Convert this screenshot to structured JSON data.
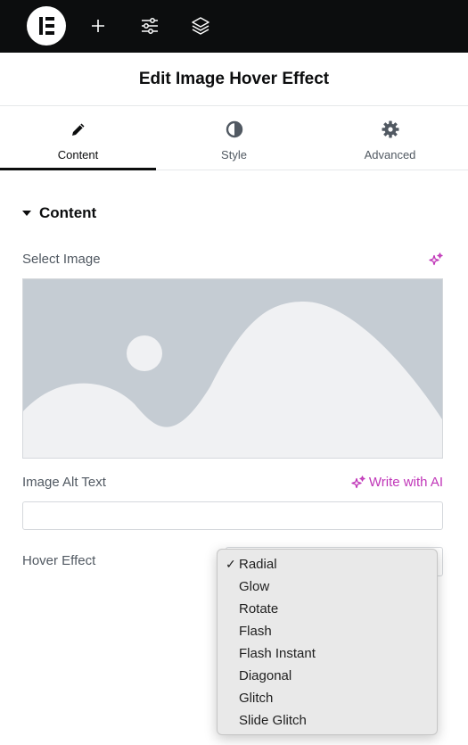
{
  "topbar": {
    "logo_icon": "elementor-logo-icon",
    "add_icon": "plus-icon",
    "settings_icon": "sliders-icon",
    "structure_icon": "layers-icon"
  },
  "header": {
    "title": "Edit Image Hover Effect"
  },
  "tabs": [
    {
      "label": "Content",
      "icon": "pencil-icon",
      "active": true
    },
    {
      "label": "Style",
      "icon": "half-circle-icon",
      "active": false
    },
    {
      "label": "Advanced",
      "icon": "gear-icon",
      "active": false
    }
  ],
  "section": {
    "title": "Content"
  },
  "fields": {
    "select_image": {
      "label": "Select Image",
      "ai_icon": "sparkle-icon"
    },
    "alt_text": {
      "label": "Image Alt Text",
      "ai_button": "Write with AI",
      "value": ""
    },
    "hover_effect": {
      "label": "Hover Effect",
      "selected": "Radial",
      "options": [
        "Radial",
        "Glow",
        "Rotate",
        "Flash",
        "Flash Instant",
        "Diagonal",
        "Glitch",
        "Slide Glitch"
      ]
    }
  },
  "colors": {
    "topbar_bg": "#0c0d0e",
    "accent_ai": "#c036b8",
    "placeholder_bg": "#c5ccd3",
    "placeholder_fg": "#f0f1f3"
  }
}
